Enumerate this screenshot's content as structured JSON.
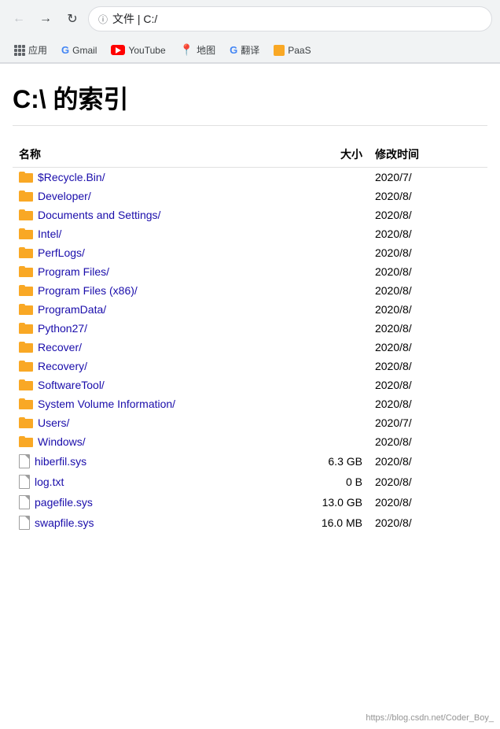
{
  "browser": {
    "address": "文件 | C:/",
    "nav": {
      "back_label": "←",
      "forward_label": "→",
      "refresh_label": "↻"
    },
    "bookmarks": [
      {
        "id": "apps",
        "label": "应用",
        "type": "apps"
      },
      {
        "id": "gmail",
        "label": "Gmail",
        "type": "google"
      },
      {
        "id": "youtube",
        "label": "YouTube",
        "type": "youtube"
      },
      {
        "id": "maps",
        "label": "地图",
        "type": "maps"
      },
      {
        "id": "translate",
        "label": "翻译",
        "type": "translate"
      },
      {
        "id": "paas",
        "label": "PaaS",
        "type": "paas"
      }
    ]
  },
  "page": {
    "title": "C:\\ 的索引",
    "columns": {
      "name": "名称",
      "size": "大小",
      "date": "修改时间"
    },
    "folders": [
      {
        "name": "$Recycle.Bin/",
        "date": "2020/7/"
      },
      {
        "name": "Developer/",
        "date": "2020/8/"
      },
      {
        "name": "Documents and Settings/",
        "date": "2020/8/"
      },
      {
        "name": "Intel/",
        "date": "2020/8/"
      },
      {
        "name": "PerfLogs/",
        "date": "2020/8/"
      },
      {
        "name": "Program Files/",
        "date": "2020/8/"
      },
      {
        "name": "Program Files (x86)/",
        "date": "2020/8/"
      },
      {
        "name": "ProgramData/",
        "date": "2020/8/"
      },
      {
        "name": "Python27/",
        "date": "2020/8/"
      },
      {
        "name": "Recover/",
        "date": "2020/8/"
      },
      {
        "name": "Recovery/",
        "date": "2020/8/"
      },
      {
        "name": "SoftwareTool/",
        "date": "2020/8/"
      },
      {
        "name": "System Volume Information/",
        "date": "2020/8/"
      },
      {
        "name": "Users/",
        "date": "2020/7/"
      },
      {
        "name": "Windows/",
        "date": "2020/8/"
      }
    ],
    "files": [
      {
        "name": "hiberfil.sys",
        "size": "6.3 GB",
        "date": "2020/8/"
      },
      {
        "name": "log.txt",
        "size": "0 B",
        "date": "2020/8/"
      },
      {
        "name": "pagefile.sys",
        "size": "13.0 GB",
        "date": "2020/8/"
      },
      {
        "name": "swapfile.sys",
        "size": "16.0 MB",
        "date": "2020/8/"
      }
    ]
  },
  "watermark": "https://blog.csdn.net/Coder_Boy_"
}
